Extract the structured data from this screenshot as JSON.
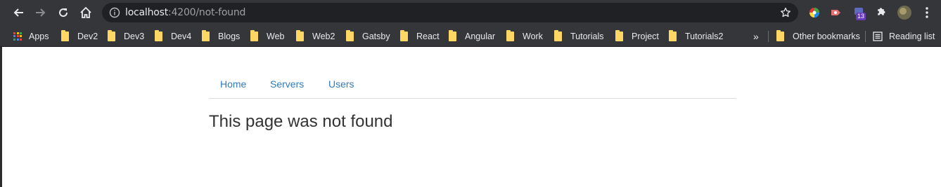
{
  "browser": {
    "address": {
      "host": "localhost",
      "rest": ":4200/not-found"
    },
    "extensions": {
      "badge_count": "13"
    }
  },
  "bookmarks": {
    "apps_label": "Apps",
    "items": [
      "Dev2",
      "Dev3",
      "Dev4",
      "Blogs",
      "Web",
      "Web2",
      "Gatsby",
      "React",
      "Angular",
      "Work",
      "Tutorials",
      "Project",
      "Tutorials2"
    ],
    "overflow_label": "»",
    "other_label": "Other bookmarks",
    "reading_list_label": "Reading list"
  },
  "page": {
    "nav": [
      "Home",
      "Servers",
      "Users"
    ],
    "heading": "This page was not found"
  },
  "colors": {
    "link": "#337ab7",
    "heading": "#333333",
    "folder": "#fdd663",
    "toolbar": "#35363a"
  }
}
